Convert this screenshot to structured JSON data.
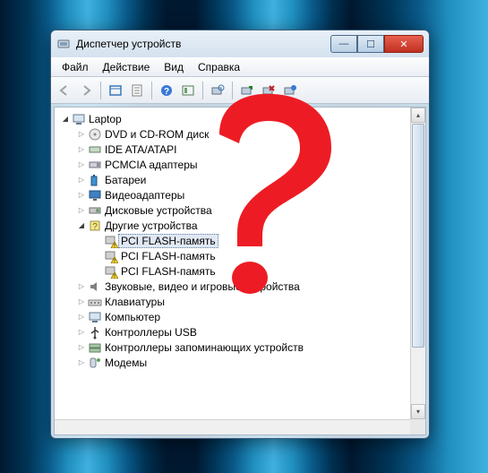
{
  "window": {
    "title": "Диспетчер устройств"
  },
  "menu": {
    "file": "Файл",
    "action": "Действие",
    "view": "Вид",
    "help": "Справка"
  },
  "tree": {
    "root": "Laptop",
    "nodes": {
      "dvd": "DVD и CD-ROM диск",
      "ide": "IDE ATA/ATAPI",
      "pcmcia": "PCMCIA адаптеры",
      "batteries": "Батареи",
      "video": "Видеоадаптеры",
      "disks": "Дисковые устройства",
      "other": "Другие устройства",
      "pci1": "PCI FLASH-память",
      "pci2": "PCI FLASH-память",
      "pci3": "PCI FLASH-память",
      "audio": "Звуковые, видео и игровые устройства",
      "keyboards": "Клавиатуры",
      "computer": "Компьютер",
      "usb": "Контроллеры USB",
      "storage": "Контроллеры запоминающих устройств",
      "modems": "Модемы"
    }
  },
  "icons": {
    "window": "device-manager",
    "toolbar": [
      "back",
      "forward",
      "up-level",
      "show-hide",
      "help",
      "properties",
      "scan",
      "update",
      "uninstall",
      "enable"
    ]
  }
}
